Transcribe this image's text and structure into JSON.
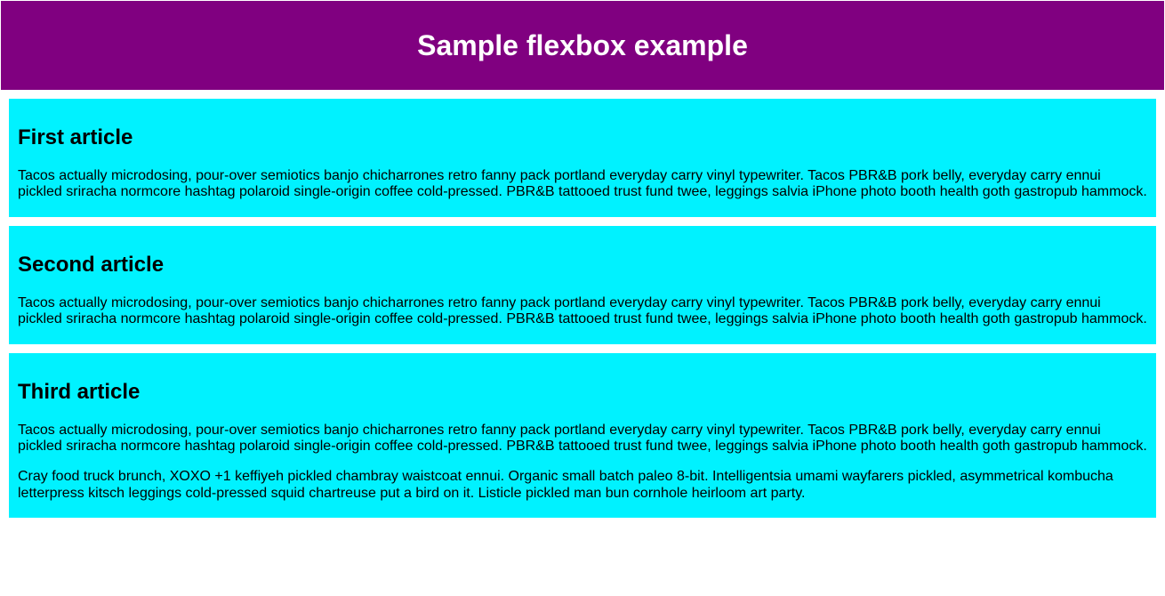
{
  "header": {
    "title": "Sample flexbox example"
  },
  "articles": [
    {
      "title": "First article",
      "paragraphs": [
        "Tacos actually microdosing, pour-over semiotics banjo chicharrones retro fanny pack portland everyday carry vinyl typewriter. Tacos PBR&B pork belly, everyday carry ennui pickled sriracha normcore hashtag polaroid single-origin coffee cold-pressed. PBR&B tattooed trust fund twee, leggings salvia iPhone photo booth health goth gastropub hammock."
      ]
    },
    {
      "title": "Second article",
      "paragraphs": [
        "Tacos actually microdosing, pour-over semiotics banjo chicharrones retro fanny pack portland everyday carry vinyl typewriter. Tacos PBR&B pork belly, everyday carry ennui pickled sriracha normcore hashtag polaroid single-origin coffee cold-pressed. PBR&B tattooed trust fund twee, leggings salvia iPhone photo booth health goth gastropub hammock."
      ]
    },
    {
      "title": "Third article",
      "paragraphs": [
        "Tacos actually microdosing, pour-over semiotics banjo chicharrones retro fanny pack portland everyday carry vinyl typewriter. Tacos PBR&B pork belly, everyday carry ennui pickled sriracha normcore hashtag polaroid single-origin coffee cold-pressed. PBR&B tattooed trust fund twee, leggings salvia iPhone photo booth health goth gastropub hammock.",
        "Cray food truck brunch, XOXO +1 keffiyeh pickled chambray waistcoat ennui. Organic small batch paleo 8-bit. Intelligentsia umami wayfarers pickled, asymmetrical kombucha letterpress kitsch leggings cold-pressed squid chartreuse put a bird on it. Listicle pickled man bun cornhole heirloom art party."
      ]
    }
  ]
}
